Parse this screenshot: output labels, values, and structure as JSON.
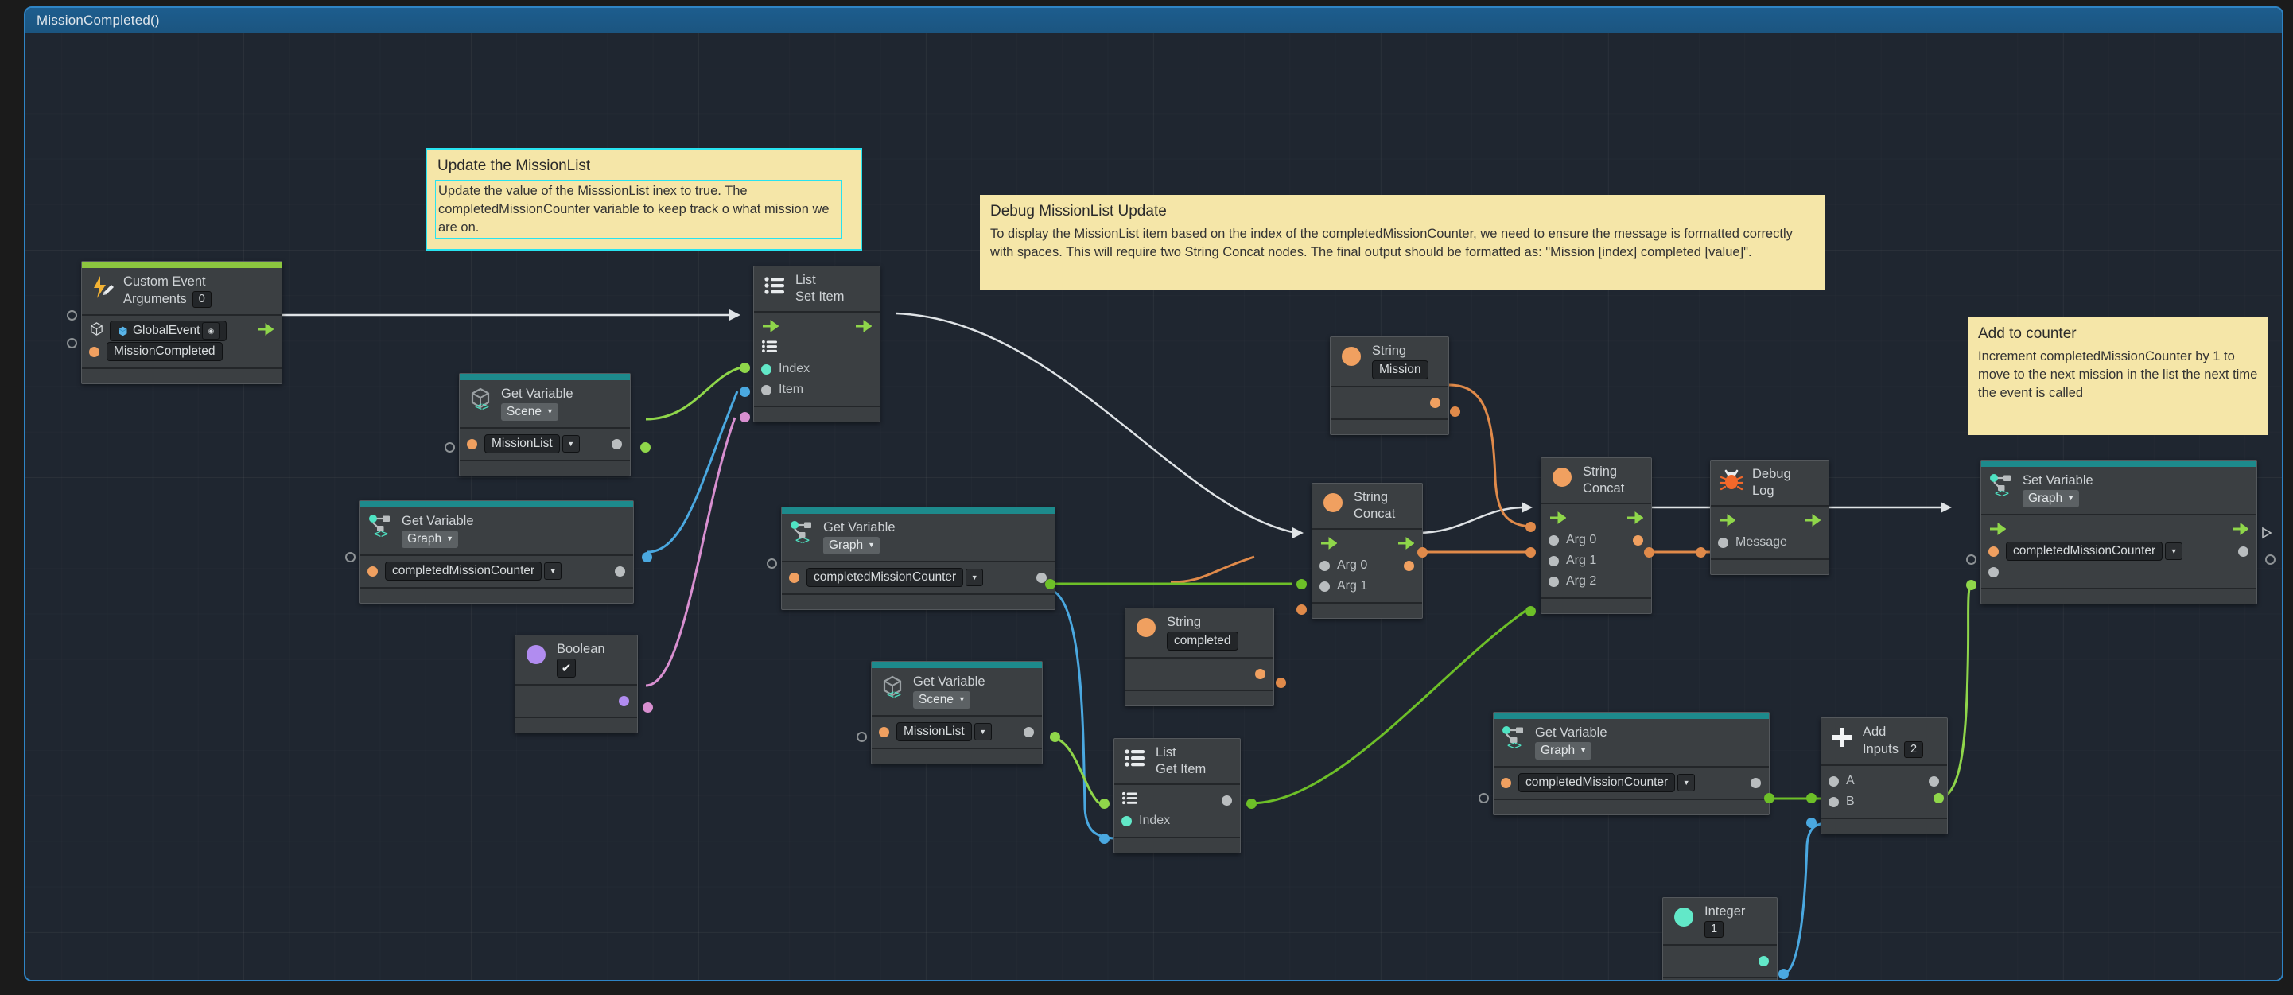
{
  "window": {
    "title": "MissionCompleted()",
    "accent_color": "#2f84c4",
    "canvas_color": "#1f2630"
  },
  "notes": [
    {
      "id": "note-update-missionlist",
      "title": "Update the MissionList",
      "body": "Update the value of the MisssionList inex to true. The completedMissionCounter variable to keep track o what mission we are on.",
      "selected": true,
      "color": "#f5e6a8"
    },
    {
      "id": "note-debug-missionlist-update",
      "title": "Debug MissionList Update",
      "body": "To display the MissionList item based on the index of the completedMissionCounter, we need to ensure the message is formatted correctly with spaces. This will require two String Concat nodes. The final output should be formatted as: \"Mission [index] completed [value]\".",
      "selected": false,
      "color": "#f5e6a8"
    },
    {
      "id": "note-add-to-counter",
      "title": "Add to counter",
      "body": "Increment completedMissionCounter by 1 to move to the next mission in the list the next time the event is called",
      "selected": false,
      "color": "#f5e6a8"
    }
  ],
  "nodes": {
    "custom_event": {
      "title": "Custom Event",
      "sub_label": "Arguments",
      "arguments": "0",
      "accent_color": "#8cc63f",
      "icon": "lightning-pencil-icon",
      "target_value": "GlobalEvent",
      "event_name": "MissionCompleted"
    },
    "get_var_missionlist_scene_top": {
      "title": "Get Variable",
      "scope": "Scene",
      "variable": "MissionList",
      "accent_color": "#1d8a8c",
      "icon": "unity-scene-variable-icon"
    },
    "list_set_item": {
      "title": "List",
      "sub_label": "Set Item",
      "port_list": "list-icon",
      "port_index": "Index",
      "port_item": "Item"
    },
    "get_var_counter_graph_left": {
      "title": "Get Variable",
      "scope": "Graph",
      "variable": "completedMissionCounter",
      "accent_color": "#1d8a8c",
      "icon": "graph-variable-icon"
    },
    "get_var_counter_graph_mid": {
      "title": "Get Variable",
      "scope": "Graph",
      "variable": "completedMissionCounter",
      "accent_color": "#1d8a8c",
      "icon": "graph-variable-icon"
    },
    "boolean_literal": {
      "title": "Boolean",
      "value": "checked",
      "checkmark": "✔"
    },
    "get_var_missionlist_scene_mid": {
      "title": "Get Variable",
      "scope": "Scene",
      "variable": "MissionList",
      "accent_color": "#1d8a8c",
      "icon": "unity-scene-variable-icon"
    },
    "list_get_item": {
      "title": "List",
      "sub_label": "Get Item",
      "port_index": "Index"
    },
    "string_mission": {
      "title": "String",
      "value": "Mission"
    },
    "string_completed": {
      "title": "String",
      "value": "completed"
    },
    "string_concat_1": {
      "title": "String",
      "sub_label": "Concat",
      "args": [
        "Arg 0",
        "Arg 1"
      ]
    },
    "string_concat_2": {
      "title": "String",
      "sub_label": "Concat",
      "args": [
        "Arg 0",
        "Arg 1",
        "Arg 2"
      ]
    },
    "debug_log": {
      "title": "Debug",
      "sub_label": "Log",
      "icon": "bug-icon",
      "port_message": "Message"
    },
    "set_var_counter_graph": {
      "title": "Set Variable",
      "scope": "Graph",
      "variable": "completedMissionCounter",
      "accent_color": "#1d8a8c",
      "icon": "graph-variable-icon"
    },
    "get_var_counter_graph_right": {
      "title": "Get Variable",
      "scope": "Graph",
      "variable": "completedMissionCounter",
      "accent_color": "#1d8a8c",
      "icon": "graph-variable-icon"
    },
    "add_node": {
      "title": "Add",
      "sub_label": "Inputs",
      "inputs": "2",
      "icon": "plus-icon",
      "port_a": "A",
      "port_b": "B"
    },
    "integer_literal": {
      "title": "Integer",
      "value": "1"
    }
  },
  "colors": {
    "flow_green": "#8fd64a",
    "string_orange": "#f0a060",
    "number_cyan": "#62e8c8",
    "bool_purple": "#b18cf0",
    "generic_grey": "#b9bdbf",
    "wire_white": "#dfe3e6",
    "wire_blue": "#4aa8e0",
    "wire_pink": "#d88fd0",
    "node_accent_teal": "#1d8a8c",
    "node_accent_green": "#8cc63f"
  }
}
